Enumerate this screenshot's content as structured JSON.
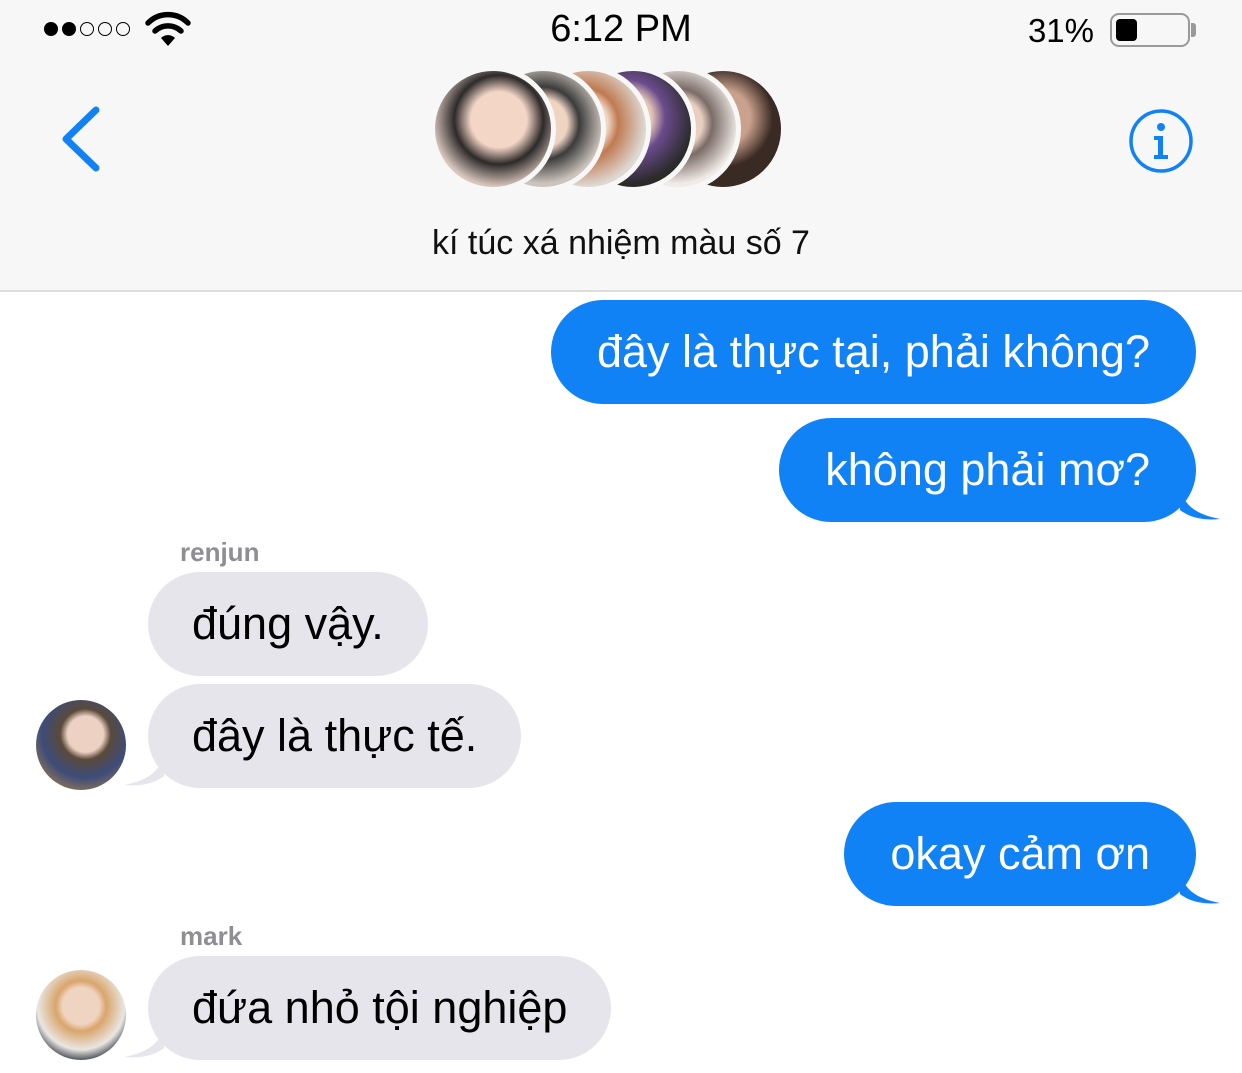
{
  "status_bar": {
    "time": "6:12 PM",
    "battery_percent": "31%",
    "battery_level": 0.31,
    "signal_bars_filled": 2,
    "signal_bars_total": 5
  },
  "header": {
    "group_name": "kí túc xá nhiệm màu số 7",
    "back_icon": "chevron-left-icon",
    "info_icon": "info-icon",
    "accent_color": "#1182f5"
  },
  "messages": [
    {
      "direction": "outgoing",
      "text": "đây là thực tại, phải không?"
    },
    {
      "direction": "outgoing",
      "text": "không phải mơ?"
    },
    {
      "direction": "incoming",
      "sender": "renjun",
      "text": "đúng vậy."
    },
    {
      "direction": "incoming",
      "sender": "renjun",
      "text": "đây là thực tế."
    },
    {
      "direction": "outgoing",
      "text": "okay cảm ơn"
    },
    {
      "direction": "incoming",
      "sender": "mark",
      "text": "đứa nhỏ tội nghiệp"
    }
  ]
}
